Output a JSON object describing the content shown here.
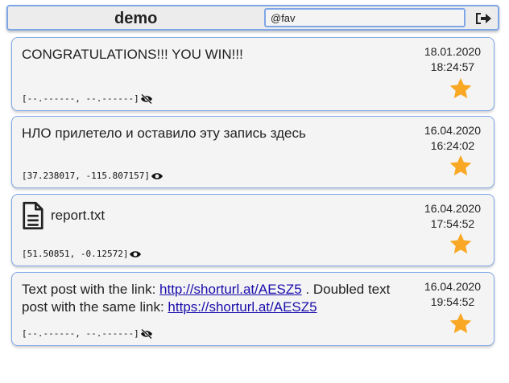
{
  "header": {
    "title": "demo",
    "search_value": "@fav",
    "logout_icon": "sign-out-icon"
  },
  "posts": [
    {
      "text": "CONGRATULATIONS!!! YOU WIN!!!",
      "date": "18.01.2020",
      "time": "18:24:57",
      "coords": "[--.------, --.------]",
      "location_icon": "eye-slash-icon",
      "favorite": true
    },
    {
      "text": "НЛО прилетело и оставило эту запись здесь",
      "date": "16.04.2020",
      "time": "16:24:02",
      "coords": "[37.238017, -115.807157]",
      "location_icon": "eye-icon",
      "favorite": true
    },
    {
      "file_name": "report.txt",
      "file_icon": "file-text-icon",
      "date": "16.04.2020",
      "time": "17:54:52",
      "coords": "[51.50851, -0.12572]",
      "location_icon": "eye-icon",
      "favorite": true
    },
    {
      "text_part1": "Text post with the link: ",
      "link1": "http://shorturl.at/AESZ5",
      "text_part2": " . Doubled text post with the same link: ",
      "link2": "https://shorturl.at/AESZ5",
      "date": "16.04.2020",
      "time": "19:54:52",
      "coords": "[--.------, --.------]",
      "location_icon": "eye-slash-icon",
      "favorite": true
    }
  ],
  "colors": {
    "accent_border": "#7fa7e8",
    "card_bg": "#f4f4f4",
    "star": "#f9a825",
    "link": "#1a0dab"
  }
}
